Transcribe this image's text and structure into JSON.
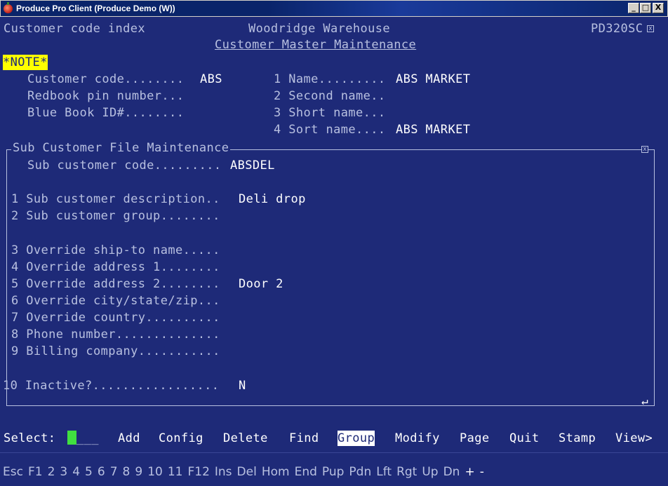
{
  "window": {
    "title": "Produce Pro Client (Produce Demo (W))",
    "buttons": {
      "minimize": "_",
      "maximize": "□",
      "close": "X"
    }
  },
  "header": {
    "left": "Customer code index",
    "center": "Woodridge Warehouse",
    "right": "PD320SC",
    "subtitle": "Customer Master Maintenance"
  },
  "note": "*NOTE*",
  "customer": {
    "code_label": "Customer code........",
    "code_value": "ABS",
    "redbook_label": "Redbook pin number...",
    "bluebook_label": "Blue Book ID#........",
    "name_label": "1 Name.........",
    "name_value": "ABS MARKET",
    "second_name_label": "2 Second name..",
    "short_name_label": "3 Short name...",
    "sort_name_label": "4 Sort name....",
    "sort_name_value": "ABS MARKET"
  },
  "sub_customer": {
    "title": "Sub Customer File Maintenance",
    "code_label": "Sub customer code.........",
    "code_value": "ABSDEL",
    "fields": [
      {
        "label": "1 Sub customer description..",
        "value": "Deli drop"
      },
      {
        "label": "2 Sub customer group........",
        "value": ""
      },
      {
        "label": "3 Override ship-to name.....",
        "value": ""
      },
      {
        "label": "4 Override address 1........",
        "value": ""
      },
      {
        "label": "5 Override address 2........",
        "value": "Door 2"
      },
      {
        "label": "6 Override city/state/zip...",
        "value": ""
      },
      {
        "label": "7 Override country..........",
        "value": ""
      },
      {
        "label": "8 Phone number..............",
        "value": ""
      },
      {
        "label": "9 Billing company...........",
        "value": ""
      },
      {
        "label": "10 Inactive?.................",
        "value": "N"
      }
    ]
  },
  "menu": {
    "select_label": "Select:",
    "select_placeholder": "___",
    "items": [
      "Add",
      "Config",
      "Delete",
      "Find",
      "Group",
      "Modify",
      "Page",
      "Quit",
      "Stamp",
      "View>"
    ],
    "highlighted": "Group"
  },
  "fkeys": [
    "Esc",
    "F1",
    "2",
    "3",
    "4",
    "5",
    "6",
    "7",
    "8",
    "9",
    "10",
    "11",
    "F12",
    "Ins",
    "Del",
    "Hom",
    "End",
    "Pup",
    "Pdn",
    "Lft",
    "Rgt",
    "Up",
    "Dn",
    "+",
    "-"
  ],
  "colors": {
    "background": "#1e2a78",
    "text": "#b8c0e0",
    "highlight": "#ffff00",
    "cursor": "#40e040"
  }
}
